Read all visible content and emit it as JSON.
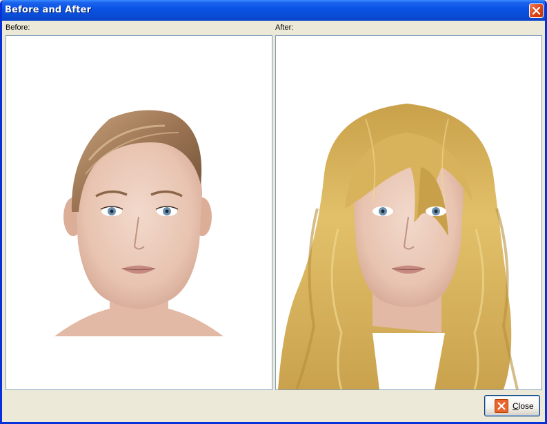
{
  "window": {
    "title": "Before and After"
  },
  "before_panel": {
    "label": "Before:"
  },
  "after_panel": {
    "label": "After:"
  },
  "close_button": {
    "mnemonic": "C",
    "rest": "lose"
  },
  "colors": {
    "titlebar": "#0a53e6",
    "face_background": "#ece9d8",
    "blonde_hair": "#d9b45c",
    "brown_hair": "#a8825f"
  }
}
